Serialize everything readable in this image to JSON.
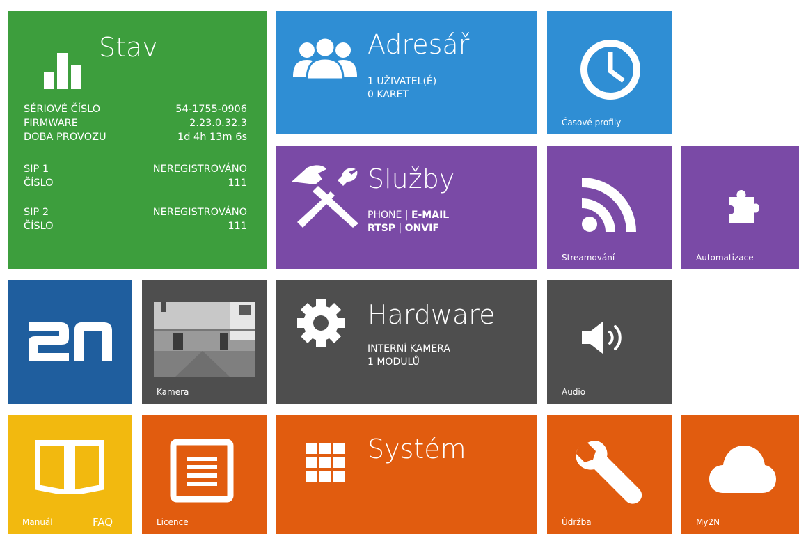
{
  "colors": {
    "green": "#3d9e3d",
    "blue": "#2f8ed4",
    "purple": "#7a4aa6",
    "dark": "#4e4e4e",
    "navy": "#1f5e9e",
    "yellow": "#f2b90f",
    "orange": "#e15c0f"
  },
  "stav": {
    "title": "Stav",
    "rows": [
      {
        "label": "SÉRIOVÉ ČÍSLO",
        "value": "54-1755-0906"
      },
      {
        "label": "FIRMWARE",
        "value": "2.23.0.32.3"
      },
      {
        "label": "DOBA PROVOZU",
        "value": "1d 4h 13m 6s"
      },
      {
        "label": "SIP 1",
        "value": "NEREGISTROVÁNO"
      },
      {
        "label": "ČÍSLO",
        "value": "111"
      },
      {
        "label": "SIP 2",
        "value": "NEREGISTROVÁNO"
      },
      {
        "label": "ČÍSLO",
        "value": "111"
      }
    ]
  },
  "adresar": {
    "title": "Adresář",
    "line1": "1 UŽIVATEL(É)",
    "line2": "0 KARET"
  },
  "casove_profily": {
    "label": "Časové profily"
  },
  "sluzby": {
    "title": "Služby",
    "phone": "PHONE",
    "sep1": " | ",
    "email": "E-MAIL",
    "rtsp": "RTSP",
    "sep2": " | ",
    "onvif": "ONVIF"
  },
  "streamovani": {
    "label": "Streamování"
  },
  "automatizace": {
    "label": "Automatizace"
  },
  "logo": {
    "text": "2N"
  },
  "kamera": {
    "label": "Kamera"
  },
  "hardware": {
    "title": "Hardware",
    "line1": "INTERNÍ KAMERA",
    "line2": "1 MODULŮ"
  },
  "audio": {
    "label": "Audio"
  },
  "manual": {
    "label": "Manuál",
    "faq": "FAQ"
  },
  "licence": {
    "label": "Licence"
  },
  "system": {
    "title": "Systém"
  },
  "udrzba": {
    "label": "Údržba"
  },
  "my2n": {
    "label": "My2N"
  },
  "icons": [
    "bar-chart-icon",
    "users-icon",
    "clock-icon",
    "tools-icon",
    "rss-icon",
    "puzzle-icon",
    "camera-preview",
    "gear-icon",
    "speaker-icon",
    "book-icon",
    "document-icon",
    "grid-icon",
    "wrench-icon",
    "cloud-icon"
  ]
}
